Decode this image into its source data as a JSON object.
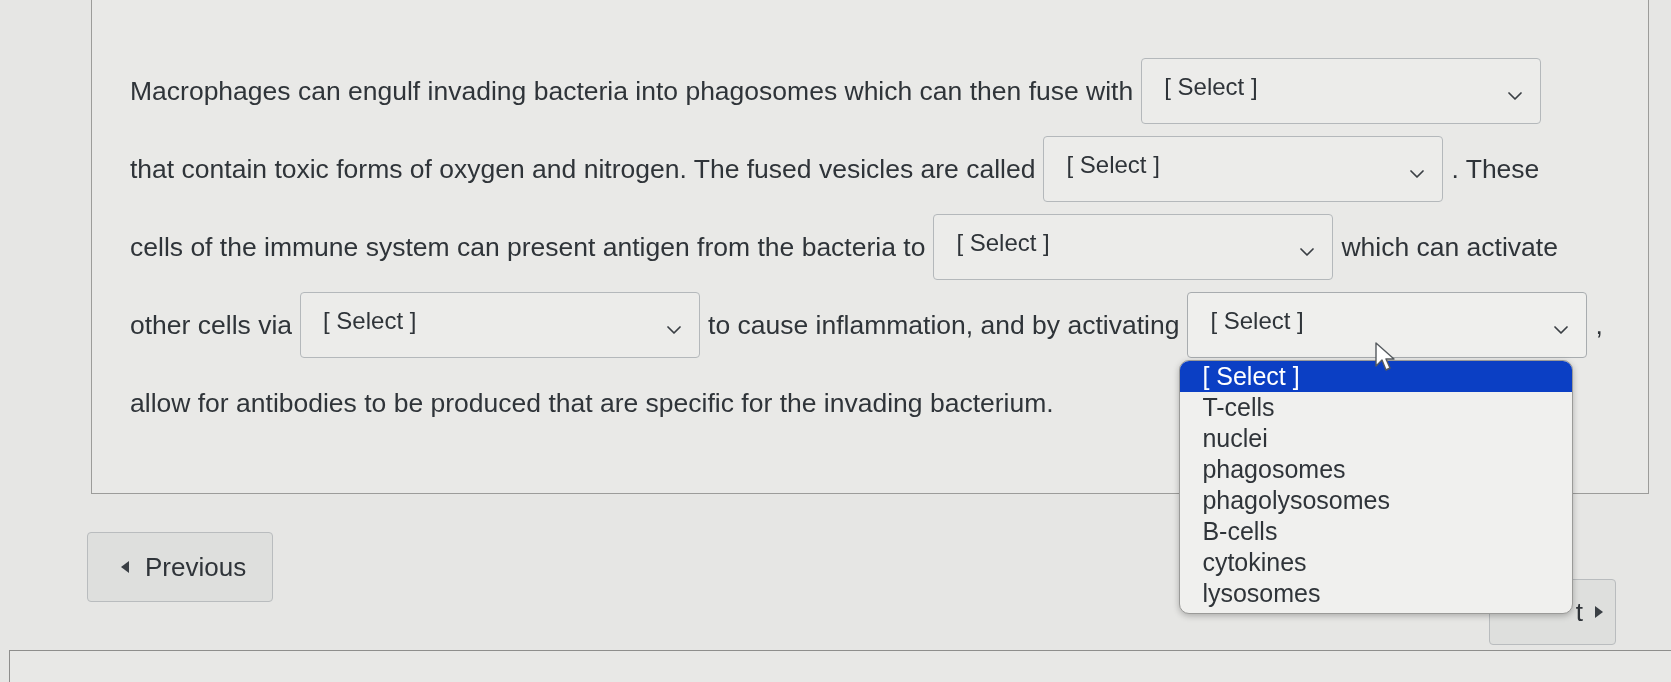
{
  "question": {
    "lines": [
      [
        {
          "kind": "text",
          "text": "Macrophages can engulf invading bacteria into phagosomes which can then fuse with"
        },
        {
          "kind": "select",
          "value": "[ Select ]",
          "expanded": false
        }
      ],
      [
        {
          "kind": "text",
          "text": "that contain toxic forms of oxygen and nitrogen. The fused vesicles are called"
        },
        {
          "kind": "select",
          "value": "[ Select ]",
          "expanded": false
        },
        {
          "kind": "text",
          "text": ". These"
        }
      ],
      [
        {
          "kind": "text",
          "text": "cells of the immune system can present antigen from the bacteria to"
        },
        {
          "kind": "select",
          "value": "[ Select ]",
          "expanded": false
        },
        {
          "kind": "text",
          "text": "which can activate"
        }
      ],
      [
        {
          "kind": "text",
          "text": "other cells via"
        },
        {
          "kind": "select",
          "value": "[ Select ]",
          "expanded": false
        },
        {
          "kind": "text",
          "text": "to cause inflammation, and by activating"
        },
        {
          "kind": "select",
          "value": "[ Select ]",
          "expanded": true,
          "options": [
            {
              "label": "[ Select ]",
              "selected": true
            },
            {
              "label": "T-cells",
              "selected": false
            },
            {
              "label": "nuclei",
              "selected": false
            },
            {
              "label": "phagosomes",
              "selected": false
            },
            {
              "label": "phagolysosomes",
              "selected": false
            },
            {
              "label": "B-cells",
              "selected": false
            },
            {
              "label": "cytokines",
              "selected": false
            },
            {
              "label": "lysosomes",
              "selected": false
            }
          ]
        },
        {
          "kind": "text",
          "text": ","
        }
      ],
      [
        {
          "kind": "text",
          "text": "allow for antibodies to be produced that are specific for the invading bacterium."
        }
      ]
    ]
  },
  "navigation": {
    "previous": {
      "label": "Previous"
    },
    "next": {
      "label": "t"
    }
  }
}
